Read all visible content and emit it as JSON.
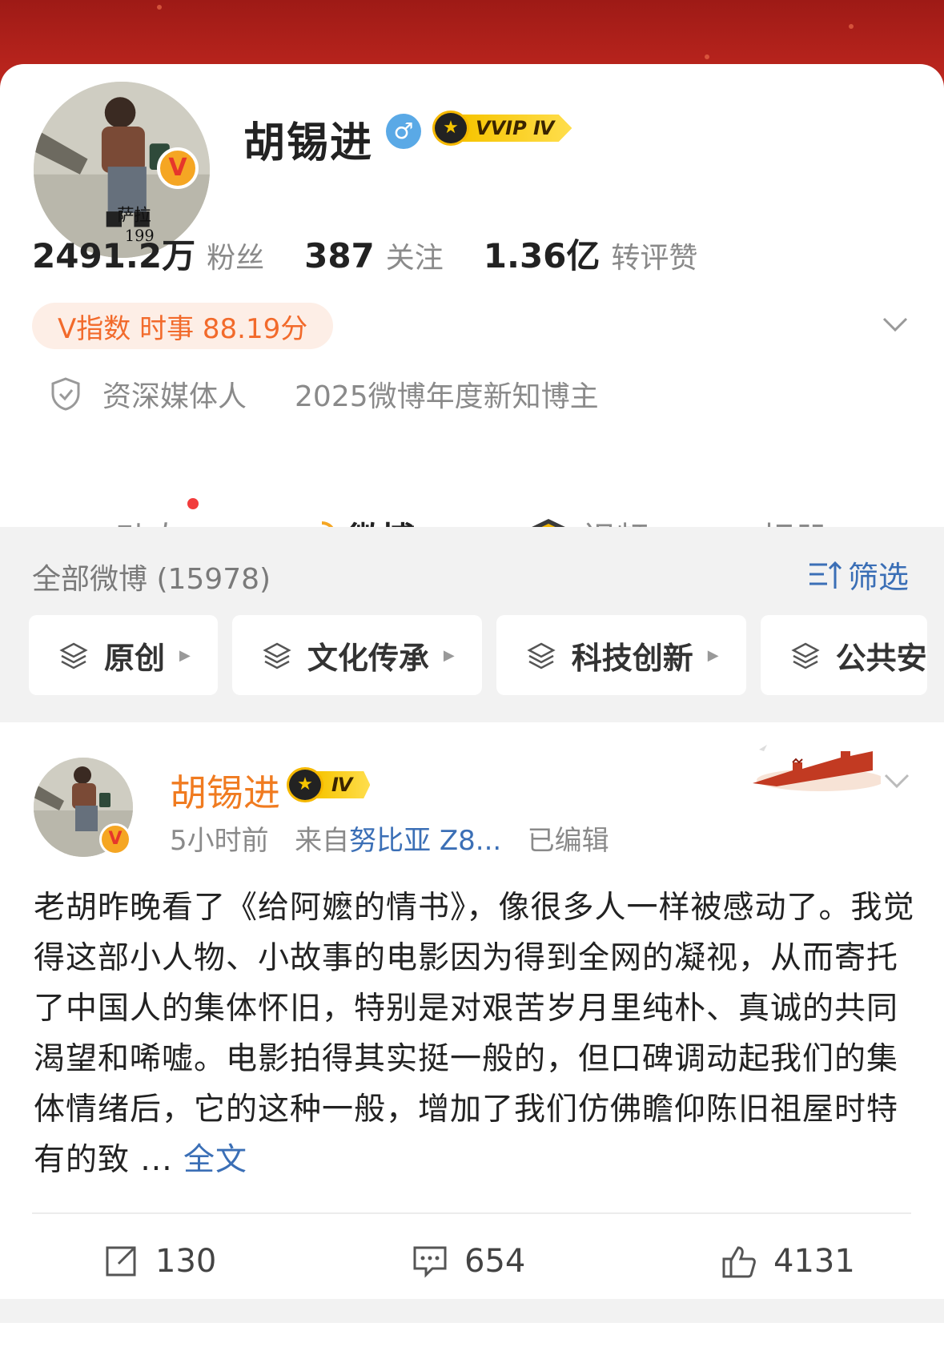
{
  "profile": {
    "name": "胡锡进",
    "vip_badge": "VVIP Ⅳ",
    "stats": [
      {
        "value": "2491.2万",
        "label": "粉丝"
      },
      {
        "value": "387",
        "label": "关注"
      },
      {
        "value": "1.36亿",
        "label": "转评赞"
      }
    ],
    "v_index": "V指数 时事 88.19分",
    "tags": [
      "资深媒体人",
      "2025微博年度新知博主"
    ]
  },
  "tabs": [
    {
      "label": "动态",
      "has_dot": true
    },
    {
      "label": "微博",
      "active": true
    },
    {
      "label": "视频"
    },
    {
      "label": "相册"
    }
  ],
  "filter": {
    "all_count": "全部微博 (15978)",
    "filter_label": "筛选",
    "chips": [
      "原创",
      "文化传承",
      "科技创新",
      "公共安"
    ]
  },
  "post": {
    "author": "胡锡进",
    "badge": "Ⅳ",
    "time": "5小时前",
    "from_prefix": "来自",
    "source": "努比亚 Z8...",
    "edited": "已编辑",
    "text": "老胡昨晚看了《给阿嬷的情书》，像很多人一样被感动了。我觉得这部小人物、小故事的电影因为得到全网的凝视，从而寄托了中国人的集体怀旧，特别是对艰苦岁月里纯朴、真诚的共同渴望和唏嘘。电影拍得其实挺一般的，但口碑调动起我们的集体情绪后，它的这种一般，增加了我们仿佛瞻仰陈旧祖屋时特有的致 ... ",
    "more_label": "全文",
    "reposts": "130",
    "comments": "654",
    "likes": "4131"
  },
  "avatar_caption": "萨拉",
  "avatar_year": "199",
  "colors": {
    "accent_orange": "#f07b20",
    "link_blue": "#3b6fb6",
    "banner_red": "#b8241d"
  }
}
